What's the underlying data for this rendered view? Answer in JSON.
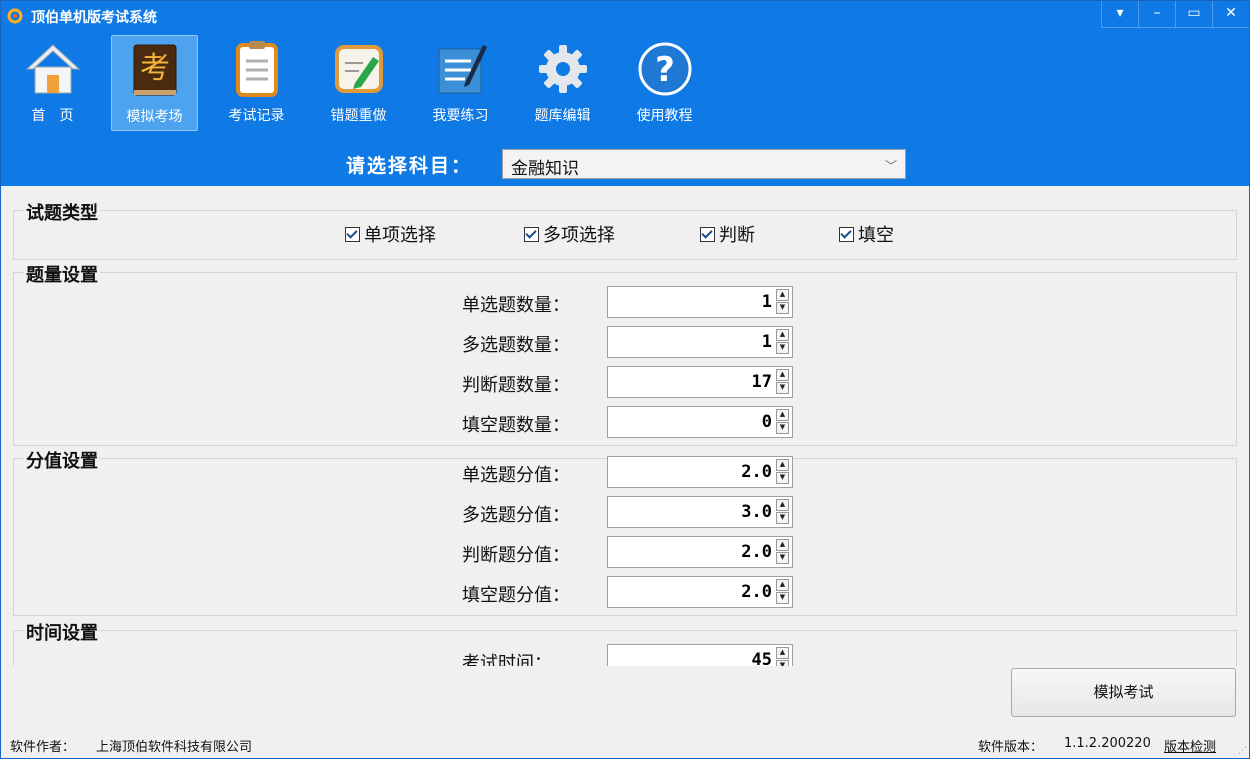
{
  "window": {
    "title": "顶伯单机版考试系统",
    "controls": [
      "▾",
      "–",
      "▭",
      "✕"
    ]
  },
  "toolbar": [
    {
      "label": "首　页",
      "icon": "home-icon",
      "active": false
    },
    {
      "label": "模拟考场",
      "icon": "exam-book-icon",
      "active": true
    },
    {
      "label": "考试记录",
      "icon": "clipboard-icon",
      "active": false
    },
    {
      "label": "错题重做",
      "icon": "pencil-paper-icon",
      "active": false
    },
    {
      "label": "我要练习",
      "icon": "notepad-pen-icon",
      "active": false
    },
    {
      "label": "题库编辑",
      "icon": "gear-icon",
      "active": false
    },
    {
      "label": "使用教程",
      "icon": "help-icon",
      "active": false
    }
  ],
  "subject": {
    "label": "请选择科目：",
    "value": "金融知识"
  },
  "question_types": {
    "title": "试题类型",
    "items": [
      {
        "label": "单项选择",
        "checked": true
      },
      {
        "label": "多项选择",
        "checked": true
      },
      {
        "label": "判断",
        "checked": true
      },
      {
        "label": "填空",
        "checked": true
      }
    ]
  },
  "quantity": {
    "title": "题量设置",
    "rows": [
      {
        "label": "单选题数量：",
        "value": "1"
      },
      {
        "label": "多选题数量：",
        "value": "1"
      },
      {
        "label": "判断题数量：",
        "value": "17"
      },
      {
        "label": "填空题数量：",
        "value": "0"
      }
    ]
  },
  "score": {
    "title": "分值设置",
    "rows": [
      {
        "label": "单选题分值：",
        "value": "2.0"
      },
      {
        "label": "多选题分值：",
        "value": "3.0"
      },
      {
        "label": "判断题分值：",
        "value": "2.0"
      },
      {
        "label": "填空题分值：",
        "value": "2.0"
      }
    ]
  },
  "time": {
    "title": "时间设置",
    "rows": [
      {
        "label": "考试时间：",
        "value": "45"
      }
    ]
  },
  "actions": {
    "start_label": "模拟考试"
  },
  "status": {
    "author_label": "软件作者：",
    "author": "上海顶伯软件科技有限公司",
    "version_label": "软件版本：",
    "version": "1.1.2.200220",
    "check_label": "版本检测"
  },
  "colors": {
    "header_blue": "#0f7ae5",
    "active_tab": "#4ea3ef"
  }
}
